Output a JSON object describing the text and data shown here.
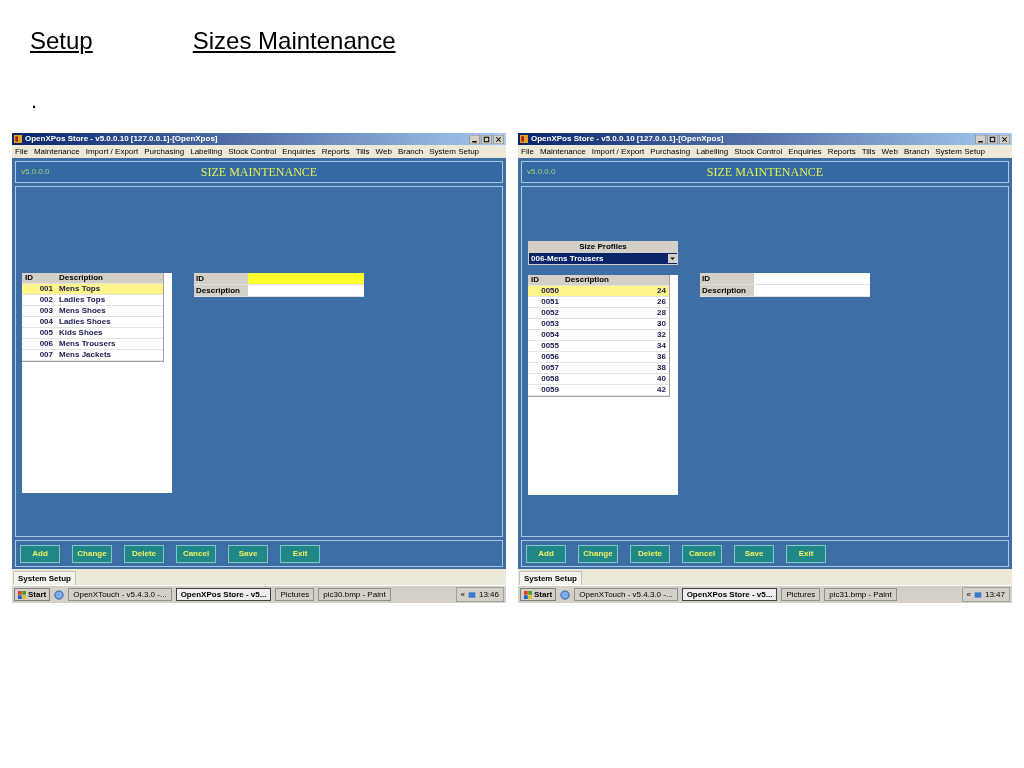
{
  "slide": {
    "title_parts": [
      "Setup",
      "Sizes Maintenance"
    ],
    "bullet": "."
  },
  "screenshots": [
    {
      "window_title": "OpenXPos Store - v5.0.0.10 [127.0.0.1]-[OpenXpos]",
      "menu": [
        "File",
        "Maintenance",
        "Import / Export",
        "Purchasing",
        "Labelling",
        "Stock Control",
        "Enquiries",
        "Reports",
        "Tills",
        "Web",
        "Branch",
        "System Setup"
      ],
      "version": "v5.0.0.0",
      "screen_title": "SIZE MAINTENANCE",
      "list": {
        "kind": "names",
        "columns": [
          "ID",
          "Description"
        ],
        "rows": [
          {
            "id": "001",
            "description": "Mens Tops",
            "selected": true
          },
          {
            "id": "002",
            "description": "Ladies Tops",
            "selected": false
          },
          {
            "id": "003",
            "description": "Mens Shoes",
            "selected": false
          },
          {
            "id": "004",
            "description": "Ladies Shoes",
            "selected": false
          },
          {
            "id": "005",
            "description": "Kids Shoes",
            "selected": false
          },
          {
            "id": "006",
            "description": "Mens Trousers",
            "selected": false
          },
          {
            "id": "007",
            "description": "Mens Jackets",
            "selected": false
          }
        ]
      },
      "form": [
        {
          "label": "ID",
          "focused": true
        },
        {
          "label": "Description",
          "focused": false
        }
      ],
      "buttons": [
        "Add",
        "Change",
        "Delete",
        "Cancel",
        "Save",
        "Exit"
      ],
      "tab": "System Setup",
      "taskbar": {
        "start": "Start",
        "tasks": [
          {
            "label": "OpenXTouch - v5.4.3.0 -...",
            "active": false
          },
          {
            "label": "OpenXPos Store - v5...",
            "active": true
          },
          {
            "label": "Pictures",
            "active": false
          },
          {
            "label": "pic30.bmp - Paint",
            "active": false
          }
        ],
        "tray": "«",
        "clock": "13:46"
      }
    },
    {
      "window_title": "OpenXPos Store - v5.0.0.10 [127.0.0.1]-[OpenXpos]",
      "menu": [
        "File",
        "Maintenance",
        "Import / Export",
        "Purchasing",
        "Labelling",
        "Stock Control",
        "Enquiries",
        "Reports",
        "Tills",
        "Web",
        "Branch",
        "System Setup"
      ],
      "version": "v5.0.0.0",
      "screen_title": "SIZE MAINTENANCE",
      "size_profiles": {
        "label": "Size Profiles",
        "value": "006-Mens Trousers"
      },
      "list": {
        "kind": "sizes",
        "columns": [
          "ID",
          "Description"
        ],
        "rows": [
          {
            "id": "0050",
            "description": "24",
            "selected": true
          },
          {
            "id": "0051",
            "description": "26",
            "selected": false
          },
          {
            "id": "0052",
            "description": "28",
            "selected": false
          },
          {
            "id": "0053",
            "description": "30",
            "selected": false
          },
          {
            "id": "0054",
            "description": "32",
            "selected": false
          },
          {
            "id": "0055",
            "description": "34",
            "selected": false
          },
          {
            "id": "0056",
            "description": "36",
            "selected": false
          },
          {
            "id": "0057",
            "description": "38",
            "selected": false
          },
          {
            "id": "0058",
            "description": "40",
            "selected": false
          },
          {
            "id": "0059",
            "description": "42",
            "selected": false
          }
        ]
      },
      "form": [
        {
          "label": "ID",
          "focused": false
        },
        {
          "label": "Description",
          "focused": false
        }
      ],
      "buttons": [
        "Add",
        "Change",
        "Delete",
        "Cancel",
        "Save",
        "Exit"
      ],
      "tab": "System Setup",
      "taskbar": {
        "start": "Start",
        "tasks": [
          {
            "label": "OpenXTouch - v5.4.3.0 -...",
            "active": false
          },
          {
            "label": "OpenXPos Store - v5...",
            "active": true
          },
          {
            "label": "Pictures",
            "active": false
          },
          {
            "label": "pic31.bmp - Paint",
            "active": false
          }
        ],
        "tray": "«",
        "clock": "13:47"
      }
    }
  ]
}
